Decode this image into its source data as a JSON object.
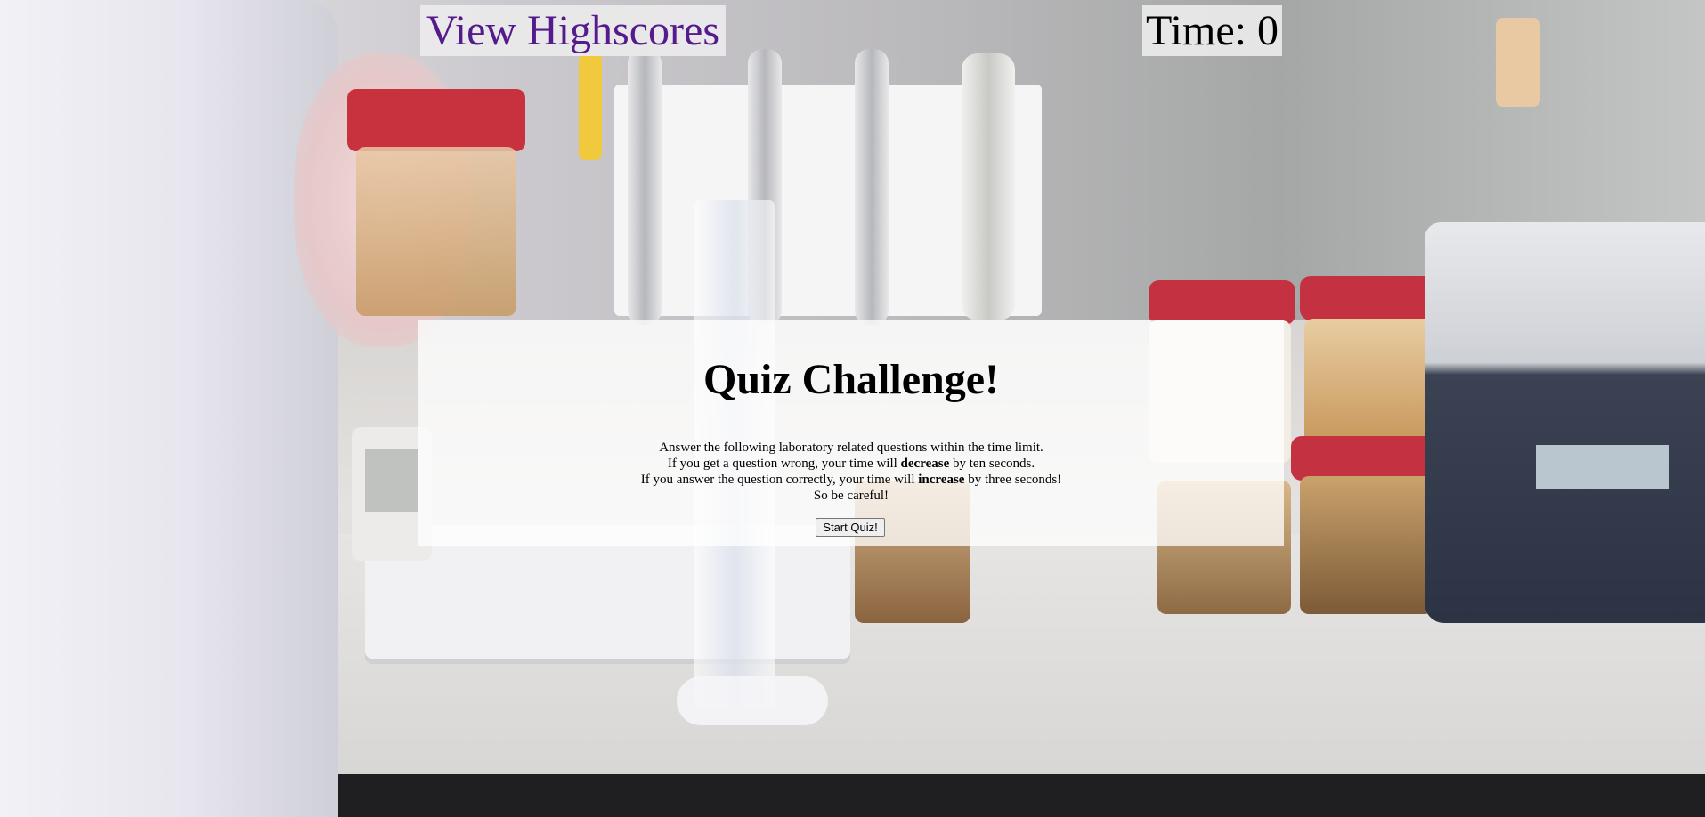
{
  "header": {
    "highscores_label": "View Highscores",
    "timer_label": "Time: 0"
  },
  "intro": {
    "title": "Quiz Challenge!",
    "line1": "Answer the following laboratory related questions within the time limit.",
    "line2_prefix": "If you get a question wrong, your time will ",
    "line2_bold": "decrease",
    "line2_suffix": " by ten seconds.",
    "line3_prefix": "If you answer the question correctly, your time will ",
    "line3_bold": "increase",
    "line3_suffix": " by three seconds!",
    "line4": "So be careful!",
    "start_button_label": "Start Quiz!"
  },
  "colors": {
    "link_visited": "#551a8b",
    "panel_background": "#ffffff"
  }
}
